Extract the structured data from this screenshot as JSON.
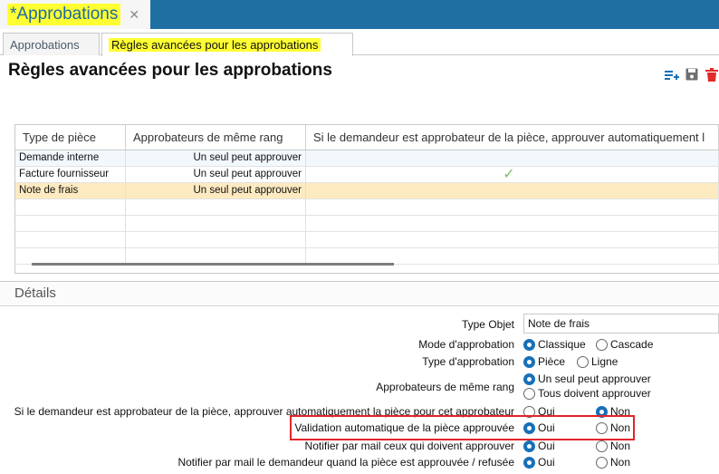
{
  "window": {
    "title": "*Approbations",
    "close_glyph": "✕"
  },
  "tabs": [
    {
      "label": "Approbations",
      "active": false
    },
    {
      "label": "Règles avancées pour les approbations",
      "active": true
    }
  ],
  "page_title": "Règles avancées pour les approbations",
  "toolbar": {
    "icons": [
      "add-row-icon",
      "save-icon",
      "delete-icon"
    ]
  },
  "grid": {
    "columns": [
      "Type de pièce",
      "Approbateurs de même rang",
      "Si le demandeur est approbateur de la pièce, approuver automatiquement l"
    ],
    "rows": [
      {
        "type": "Demande interne",
        "rank": "Un seul peut approuver",
        "auto": false
      },
      {
        "type": "Facture fournisseur",
        "rank": "Un seul peut approuver",
        "auto": true
      },
      {
        "type": "Note de frais",
        "rank": "Un seul peut approuver",
        "auto": false,
        "selected": true
      }
    ],
    "check_glyph": "✓"
  },
  "details": {
    "title": "Détails",
    "type_objet": {
      "label": "Type Objet",
      "value": "Note de frais"
    },
    "mode": {
      "label": "Mode d'approbation",
      "options": [
        "Classique",
        "Cascade"
      ],
      "selected": "Classique"
    },
    "type_appro": {
      "label": "Type d'approbation",
      "options": [
        "Pièce",
        "Ligne"
      ],
      "selected": "Pièce"
    },
    "rank": {
      "label": "Approbateurs de même rang",
      "options": [
        "Un seul peut approuver",
        "Tous doivent approuver"
      ],
      "selected": "Un seul peut approuver"
    },
    "auto_approve": {
      "label": "Si le demandeur est approbateur de la pièce, approuver automatiquement la pièce pour cet approbateur",
      "options": [
        "Oui",
        "Non"
      ],
      "selected": "Non"
    },
    "auto_validation": {
      "label": "Validation automatique de la pièce approuvée",
      "options": [
        "Oui",
        "Non"
      ],
      "selected": "Oui"
    },
    "notify_approvers": {
      "label": "Notifier par mail ceux qui doivent approuver",
      "options": [
        "Oui",
        "Non"
      ],
      "selected": "Oui"
    },
    "notify_requester": {
      "label": "Notifier par mail le demandeur quand la pièce est approuvée / refusée",
      "options": [
        "Oui",
        "Non"
      ],
      "selected": "Oui"
    }
  },
  "colors": {
    "accent": "#1770b8",
    "highlight_yellow": "#ffff33",
    "annotation_red": "#e1252a",
    "selected_row": "#fdeac0"
  }
}
